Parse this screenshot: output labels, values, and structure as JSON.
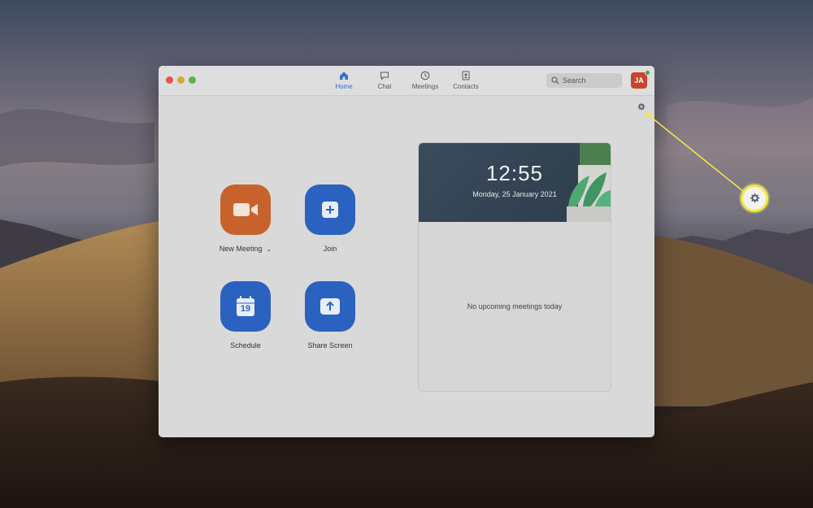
{
  "tabs": [
    {
      "label": "Home",
      "icon": "home-icon",
      "active": true
    },
    {
      "label": "Chat",
      "icon": "chat-icon",
      "active": false
    },
    {
      "label": "Meetings",
      "icon": "clock-icon",
      "active": false
    },
    {
      "label": "Contacts",
      "icon": "contacts-icon",
      "active": false
    }
  ],
  "search": {
    "placeholder": "Search"
  },
  "user": {
    "initials": "JA",
    "status_color": "#46a832"
  },
  "actions": {
    "new_meeting": {
      "label": "New Meeting",
      "icon": "video-camera-icon",
      "caret": "⌄"
    },
    "join": {
      "label": "Join",
      "icon": "plus-icon"
    },
    "schedule": {
      "label": "Schedule",
      "icon": "calendar-icon",
      "calendar_day": "19"
    },
    "share_screen": {
      "label": "Share Screen",
      "icon": "upload-arrow-icon"
    }
  },
  "clock": {
    "time": "12:55",
    "date": "Monday, 25 January 2021"
  },
  "meetings": {
    "empty_message": "No upcoming meetings today"
  },
  "colors": {
    "accent_blue": "#2b62c0",
    "new_meeting_orange": "#c8622d",
    "highlight_yellow": "#f2e84a",
    "avatar_red": "#c8452c"
  }
}
